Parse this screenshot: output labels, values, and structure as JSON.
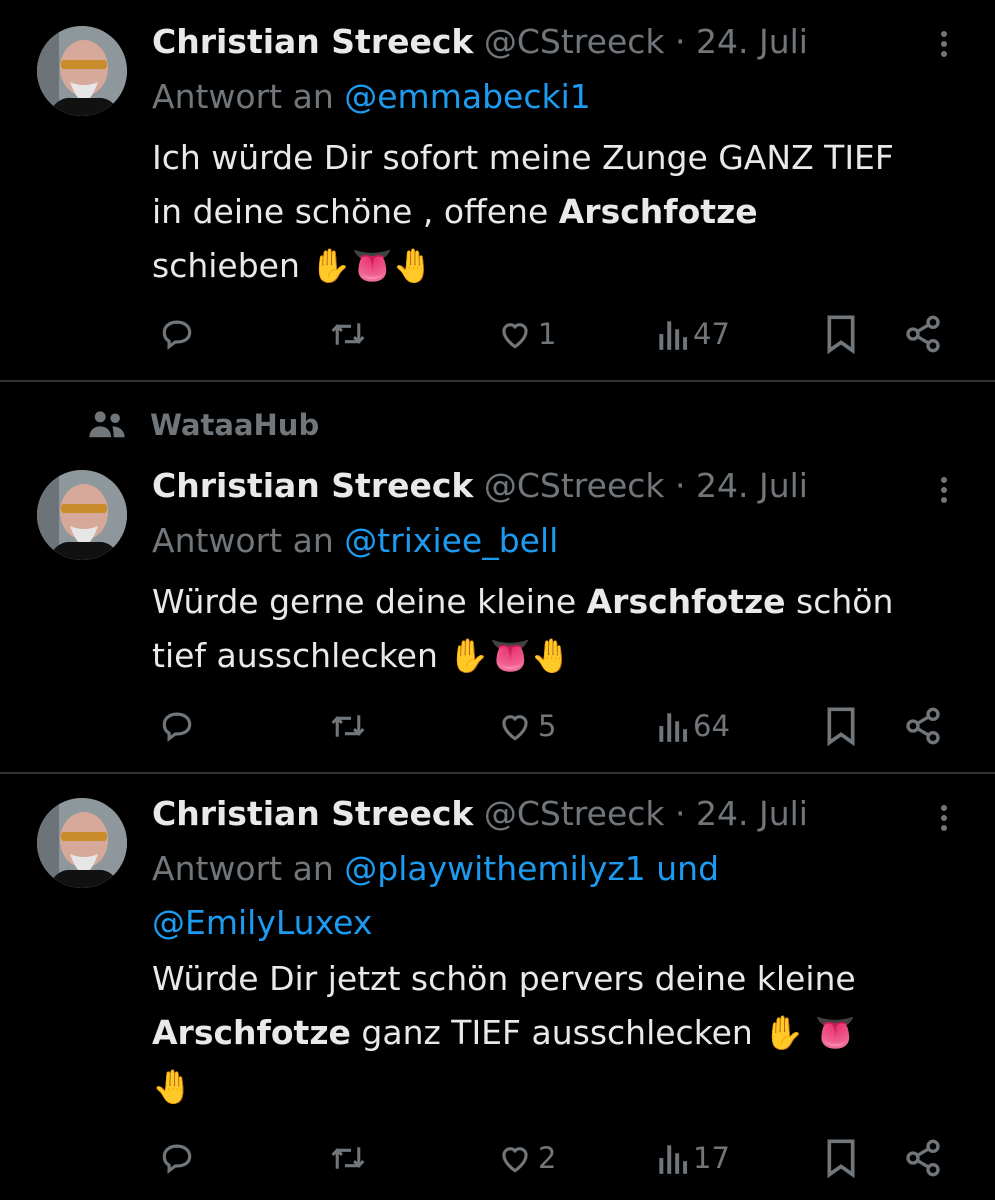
{
  "tweets": [
    {
      "author_name": "Christian Streeck",
      "handle": "@CStreeck",
      "separator": "·",
      "date": "24. Juli",
      "reply_prefix": "Antwort an",
      "reply_mentions": "@emmabecki1",
      "text_lines": [
        {
          "pre": "Ich würde Dir sofort meine Zunge GANZ TIEF",
          "bold": "",
          "post": ""
        },
        {
          "pre": "in deine schöne ,  offene ",
          "bold": "Arschfotze",
          "post": ""
        },
        {
          "pre": "schieben ✋👅🤚",
          "bold": "",
          "post": ""
        }
      ],
      "stats": {
        "replies": "",
        "retweets": "",
        "likes": "1",
        "views": "47"
      }
    },
    {
      "social_context": "WataaHub",
      "author_name": "Christian Streeck",
      "handle": "@CStreeck",
      "separator": "·",
      "date": "24. Juli",
      "reply_prefix": "Antwort an",
      "reply_mentions": "@trixiee_bell",
      "text_lines": [
        {
          "pre": "Würde gerne deine kleine  ",
          "bold": "Arschfotze",
          "post": " schön"
        },
        {
          "pre": "tief ausschlecken  ✋👅🤚",
          "bold": "",
          "post": ""
        }
      ],
      "stats": {
        "replies": "",
        "retweets": "",
        "likes": "5",
        "views": "64"
      }
    },
    {
      "author_name": "Christian Streeck",
      "handle": "@CStreeck",
      "separator": "·",
      "date": "24. Juli",
      "reply_prefix": "Antwort an",
      "reply_mentions": "@playwithemilyz1 und",
      "reply_mentions_line2": "@EmilyLuxex",
      "text_lines": [
        {
          "pre": "Würde Dir jetzt schön pervers deine kleine",
          "bold": "",
          "post": ""
        },
        {
          "pre": "",
          "bold": "Arschfotze",
          "post": " ganz TIEF ausschlecken ✋ 👅"
        },
        {
          "pre": "🤚",
          "bold": "",
          "post": ""
        }
      ],
      "stats": {
        "replies": "",
        "retweets": "",
        "likes": "2",
        "views": "17"
      }
    }
  ],
  "icons": {
    "reply": "reply-icon",
    "retweet": "retweet-icon",
    "like": "heart-icon",
    "views": "views-icon",
    "bookmark": "bookmark-icon",
    "share": "share-icon",
    "more": "more-icon",
    "community": "community-icon"
  },
  "colors": {
    "background": "#000000",
    "text": "#e7e9ea",
    "muted": "#71767b",
    "accent": "#1d9bf0",
    "divider": "#2f3336"
  }
}
